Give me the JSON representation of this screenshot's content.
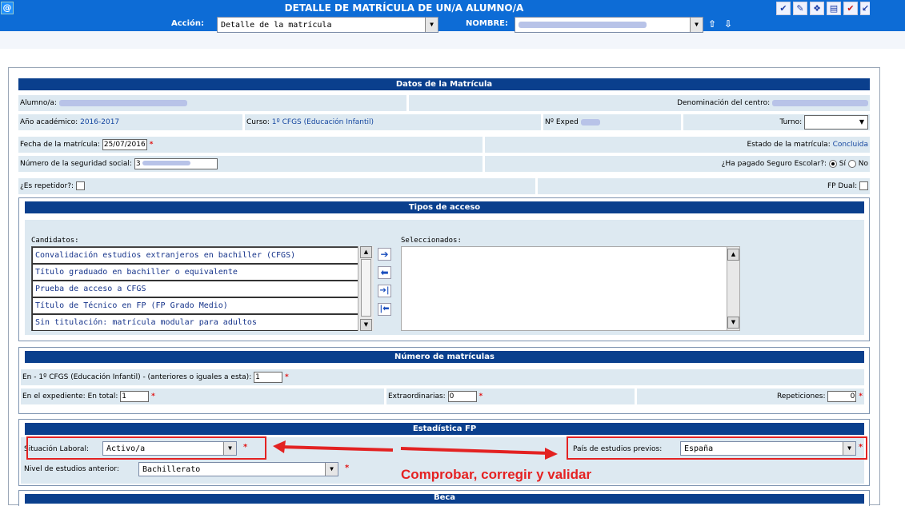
{
  "header": {
    "at_symbol": "@",
    "title": "DETALLE DE MATRÍCULA DE UN/A ALUMNO/A",
    "icons": [
      "check-icon",
      "edit-icon",
      "books-icon",
      "document-icon",
      "check-red-icon",
      "back-icon"
    ]
  },
  "action": {
    "label": "Acción:",
    "value": "Detalle de la matrícula",
    "nombre_label": "NOMBRE:",
    "up": "⇧",
    "down": "⇩"
  },
  "datos": {
    "title": "Datos de la Matrícula",
    "alumno_label": "Alumno/a:",
    "centro_label": "Denominación del centro:",
    "anio_label": "Año académico:",
    "anio_value": "2016-2017",
    "curso_label": "Curso:",
    "curso_value": "1º CFGS (Educación Infantil)",
    "exped_label": "Nº Exped",
    "turno_label": "Turno:",
    "fecha_label": "Fecha de la matrícula:",
    "fecha_value": "25/07/2016",
    "estado_label": "Estado de la matrícula:",
    "estado_value": "Concluida",
    "ss_label": "Número de la seguridad social:",
    "ss_prefix": "3",
    "seguro_label": "¿Ha pagado Seguro Escolar?:",
    "si": "Sí",
    "no": "No",
    "repetidor_label": "¿Es repetidor?:",
    "fpdual_label": "FP Dual:"
  },
  "acceso": {
    "title": "Tipos de acceso",
    "candidatos_label": "Candidatos:",
    "seleccionados_label": "Seleccionados:",
    "candidatos": [
      "Convalidación estudios extranjeros en bachiller (CFGS)",
      "Título graduado en bachiller o equivalente",
      "Prueba de acceso a CFGS",
      "Título de Técnico en FP (FP Grado Medio)",
      "Sin titulación: matrícula modular para adultos"
    ]
  },
  "matriculas": {
    "title": "Número de matrículas",
    "en_label": "En - 1º CFGS (Educación Infantil) - (anteriores o iguales a esta):",
    "en_value": "1",
    "total_label": "En el expediente: En total:",
    "total_value": "1",
    "extra_label": "Extraordinarias:",
    "extra_value": "0",
    "rep_label": "Repeticiones:",
    "rep_value": "0"
  },
  "estadistica": {
    "title": "Estadística FP",
    "situacion_label": "Situación Laboral:",
    "situacion_value": "Activo/a",
    "pais_label": "País de estudios previos:",
    "pais_value": "España",
    "nivel_label": "Nivel de estudios anterior:",
    "nivel_value": "Bachillerato"
  },
  "annotation": "Comprobar, corregir y validar",
  "becas_title": "Beca",
  "req": "*",
  "colors": {
    "header": "#0d6cd6",
    "section": "#0a3f8d",
    "row": "#dde9f1",
    "annotation": "#e52222"
  }
}
